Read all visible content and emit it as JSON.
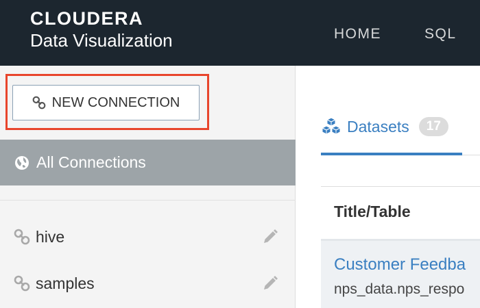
{
  "header": {
    "brand_name": "CLOUDERA",
    "brand_subtitle": "Data Visualization",
    "nav": [
      {
        "label": "HOME"
      },
      {
        "label": "SQL"
      }
    ]
  },
  "sidebar": {
    "new_connection_label": "NEW CONNECTION",
    "all_connections_label": "All Connections",
    "connections": [
      {
        "label": "hive",
        "icon": "link-icon"
      },
      {
        "label": "samples",
        "icon": "link-icon"
      }
    ]
  },
  "main": {
    "tab_label": "Datasets",
    "tab_count": "17",
    "column_header": "Title/Table",
    "rows": [
      {
        "title": "Customer Feedba",
        "table": "nps_data.nps_respo"
      }
    ]
  },
  "colors": {
    "topbar": "#1c262f",
    "accent_blue": "#3a7fc1",
    "highlight_red": "#e8452c",
    "active_connection_bg": "#9da4a8"
  }
}
